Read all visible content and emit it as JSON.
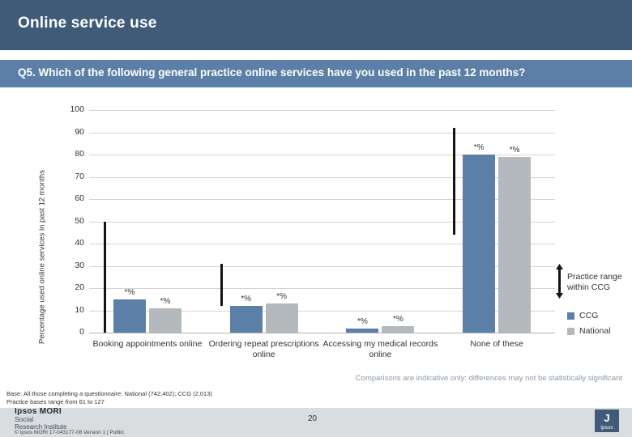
{
  "header": {
    "title": "Online service use",
    "subtitle": "Q5. Which of the following general practice online services have you used in the past 12 months?"
  },
  "chart_data": {
    "type": "bar",
    "title": "",
    "xlabel": "",
    "ylabel": "Percentage used online services in past 12 months",
    "ylim": [
      0,
      100
    ],
    "yticks": [
      0,
      10,
      20,
      30,
      40,
      50,
      60,
      70,
      80,
      90,
      100
    ],
    "grid": true,
    "legend_position": "right",
    "categories": [
      "Booking appointments online",
      "Ordering repeat prescriptions online",
      "Accessing my medical records online",
      "None of these"
    ],
    "series": [
      {
        "name": "CCG",
        "color": "#5b7fa6",
        "values": [
          15,
          12,
          2,
          0
        ],
        "labels": [
          "*%",
          "*%",
          "*%",
          ""
        ]
      },
      {
        "name": "National",
        "color": "#b3b9bd",
        "values": [
          11,
          13,
          3,
          0
        ],
        "labels": [
          "*%",
          "*%",
          "*%",
          ""
        ]
      }
    ],
    "extra_bars": [
      {
        "category": "None of these",
        "series": "CCG",
        "value": 80,
        "label": "*%"
      },
      {
        "category": "None of these",
        "series": "National",
        "value": 79,
        "label": "*%"
      }
    ],
    "practice_ranges": [
      {
        "category": "Booking appointments online",
        "low": 0,
        "high": 50
      },
      {
        "category": "Ordering repeat prescriptions online",
        "low": 12,
        "high": 31
      },
      {
        "category": "None of these",
        "low": 44,
        "high": 92
      }
    ],
    "annotations": {
      "range_label_line1": "Practice range",
      "range_label_line2": "within CCG"
    }
  },
  "notes": {
    "comparison": "Comparisons are indicative only: differences may not be statistically significant",
    "base_line1": "Base: All those completing a questionnaire: National (742,402); CCG (2,013)",
    "base_line2": "Practice bases range from 61 to 127"
  },
  "footer": {
    "logo_line1": "Ipsos MORI",
    "logo_line2": "Social",
    "logo_line3": "Research Institute",
    "copyright": "© Ipsos MORI      17-043177-08 Version 1 | Public",
    "page_number": "20",
    "badge_mark": "J",
    "badge_text": "Ipsos"
  }
}
